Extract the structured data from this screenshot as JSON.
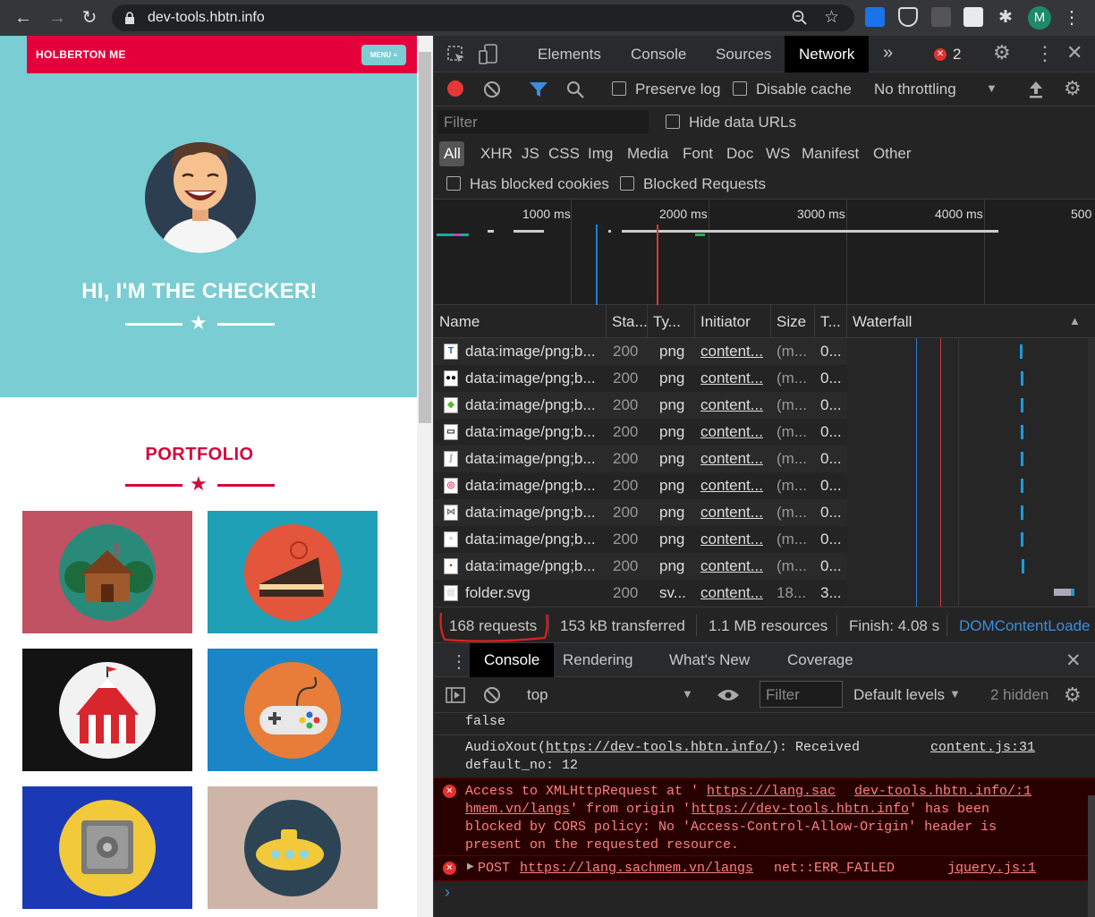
{
  "browser": {
    "url": "dev-tools.hbtn.info",
    "profile_initial": "M"
  },
  "page": {
    "brand": "HOLBERTON ME",
    "menu_label": "MENU ≡",
    "hero_title": "HI, I'M THE CHECKER!",
    "portfolio_title": "PORTFOLIO",
    "tiles": [
      {
        "name": "cabin",
        "bg": "#c15264"
      },
      {
        "name": "cake",
        "bg": "#20a0b6"
      },
      {
        "name": "circus",
        "bg": "#141313"
      },
      {
        "name": "controller",
        "bg": "#1c85c8"
      },
      {
        "name": "safe",
        "bg": "#1b39b5"
      },
      {
        "name": "submarine",
        "bg": "#ceb5a7"
      }
    ]
  },
  "devtools": {
    "tabs": [
      "Elements",
      "Console",
      "Sources",
      "Network"
    ],
    "active_tab": "Network",
    "more_tabs": "»",
    "error_count": "2",
    "toolbar": {
      "preserve_log": "Preserve log",
      "disable_cache": "Disable cache",
      "throttling": "No throttling"
    },
    "filter_placeholder": "Filter",
    "hide_data_urls": "Hide data URLs",
    "type_filters": [
      "All",
      "XHR",
      "JS",
      "CSS",
      "Img",
      "Media",
      "Font",
      "Doc",
      "WS",
      "Manifest",
      "Other"
    ],
    "has_blocked_cookies": "Has blocked cookies",
    "blocked_requests": "Blocked Requests",
    "timeline_ticks": [
      "1000 ms",
      "2000 ms",
      "3000 ms",
      "4000 ms",
      "500"
    ],
    "columns": [
      "Name",
      "Sta...",
      "Ty...",
      "Initiator",
      "Size",
      "T...",
      "Waterfall"
    ],
    "requests": [
      {
        "name": "data:image/png;b...",
        "status": "200",
        "type": "png",
        "initiator": "content...",
        "size": "(m...",
        "time": "0...",
        "icon_color": "#1a4fd6",
        "icon_char": "T"
      },
      {
        "name": "data:image/png;b...",
        "status": "200",
        "type": "png",
        "initiator": "content...",
        "size": "(m...",
        "time": "0...",
        "icon_color": "#111111",
        "icon_char": "●●"
      },
      {
        "name": "data:image/png;b...",
        "status": "200",
        "type": "png",
        "initiator": "content...",
        "size": "(m...",
        "time": "0...",
        "icon_color": "#5cb82e",
        "icon_char": "◆"
      },
      {
        "name": "data:image/png;b...",
        "status": "200",
        "type": "png",
        "initiator": "content...",
        "size": "(m...",
        "time": "0...",
        "icon_color": "#222222",
        "icon_char": "▭"
      },
      {
        "name": "data:image/png;b...",
        "status": "200",
        "type": "png",
        "initiator": "content...",
        "size": "(m...",
        "time": "0...",
        "icon_color": "#999999",
        "icon_char": "ʃ"
      },
      {
        "name": "data:image/png;b...",
        "status": "200",
        "type": "png",
        "initiator": "content...",
        "size": "(m...",
        "time": "0...",
        "icon_color": "#e8366a",
        "icon_char": "◎"
      },
      {
        "name": "data:image/png;b...",
        "status": "200",
        "type": "png",
        "initiator": "content...",
        "size": "(m...",
        "time": "0...",
        "icon_color": "#777777",
        "icon_char": "⋈"
      },
      {
        "name": "data:image/png;b...",
        "status": "200",
        "type": "png",
        "initiator": "content...",
        "size": "(m...",
        "time": "0...",
        "icon_color": "#4a7bd0",
        "icon_char": "▫"
      },
      {
        "name": "data:image/png;b...",
        "status": "200",
        "type": "png",
        "initiator": "content...",
        "size": "(m...",
        "time": "0...",
        "icon_color": "#b04a2a",
        "icon_char": "▪"
      },
      {
        "name": "folder.svg",
        "status": "200",
        "type": "sv...",
        "initiator": "content...",
        "size": "18...",
        "time": "3...",
        "icon_color": "#dddddd",
        "icon_char": "▤"
      }
    ],
    "summary": {
      "requests": "168 requests",
      "transferred": "153 kB transferred",
      "resources": "1.1 MB resources",
      "finish": "Finish: 4.08 s",
      "dcl": "DOMContentLoade"
    },
    "drawer_tabs": [
      "Console",
      "Rendering",
      "What's New",
      "Coverage"
    ],
    "console_toolbar": {
      "context": "top",
      "filter_placeholder": "Filter",
      "levels": "Default levels",
      "hidden": "2 hidden"
    },
    "console": {
      "line_false": "false",
      "log1_a": "AudioXout(",
      "log1_link": "https://dev-tools.hbtn.info/",
      "log1_b": "): Received",
      "log1_c": "default_no: 12",
      "log1_src": "content.js:31",
      "err1_1a": "Access to XMLHttpRequest at '",
      "err1_1link": "https://lang.sac",
      "err1_src": "dev-tools.hbtn.info/:1",
      "err1_2link": "hmem.vn/langs",
      "err1_2b": "' from origin '",
      "err1_2link2": "https://dev-tools.hbtn.info",
      "err1_2c": "' has been",
      "err1_3": "blocked by CORS policy: No 'Access-Control-Allow-Origin' header is",
      "err1_4": "present on the requested resource.",
      "err2_method": "POST",
      "err2_link": "https://lang.sachmem.vn/langs",
      "err2_text": "net::ERR_FAILED",
      "err2_src": "jquery.js:1",
      "prompt": "›"
    }
  }
}
